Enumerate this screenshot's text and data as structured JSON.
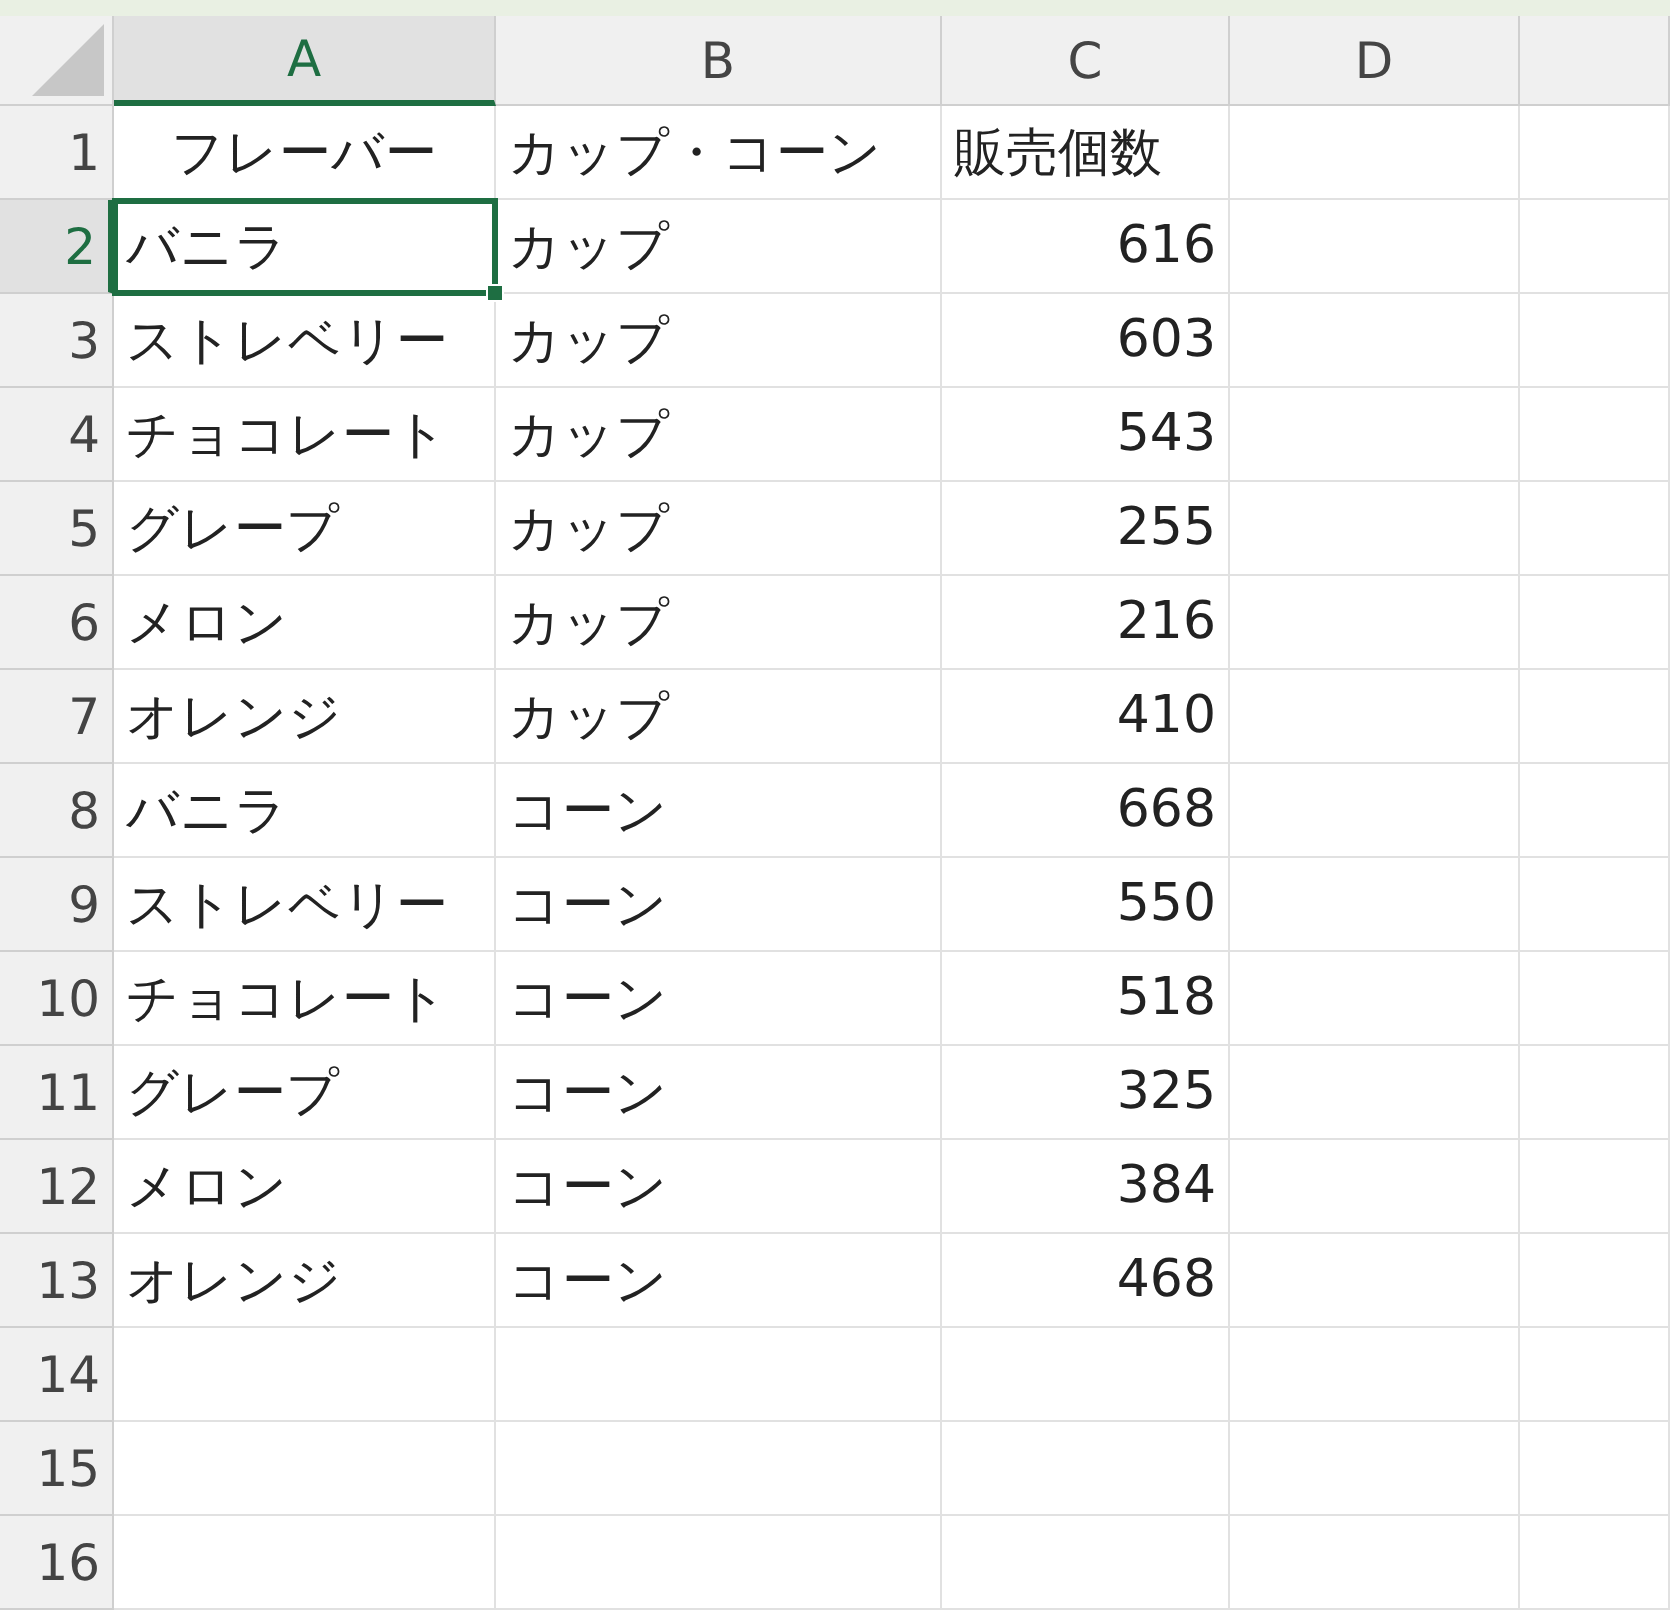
{
  "columns": [
    {
      "label": "A",
      "selected": true
    },
    {
      "label": "B",
      "selected": false
    },
    {
      "label": "C",
      "selected": false
    },
    {
      "label": "D",
      "selected": false
    },
    {
      "selected": false
    }
  ],
  "rows": [
    {
      "label": "1",
      "selected": false,
      "cells": [
        {
          "text": "フレーバー",
          "kind": "center"
        },
        {
          "text": "カップ・コーン",
          "kind": "text"
        },
        {
          "text": "販売個数",
          "kind": "text"
        }
      ]
    },
    {
      "label": "2",
      "selected": true,
      "cells": [
        {
          "text": "バニラ",
          "kind": "text"
        },
        {
          "text": "カップ",
          "kind": "text"
        },
        {
          "text": "616",
          "kind": "number"
        }
      ]
    },
    {
      "label": "3",
      "selected": false,
      "cells": [
        {
          "text": "ストレベリー",
          "kind": "text"
        },
        {
          "text": "カップ",
          "kind": "text"
        },
        {
          "text": "603",
          "kind": "number"
        }
      ]
    },
    {
      "label": "4",
      "selected": false,
      "cells": [
        {
          "text": "チョコレート",
          "kind": "text"
        },
        {
          "text": "カップ",
          "kind": "text"
        },
        {
          "text": "543",
          "kind": "number"
        }
      ]
    },
    {
      "label": "5",
      "selected": false,
      "cells": [
        {
          "text": "グレープ",
          "kind": "text"
        },
        {
          "text": "カップ",
          "kind": "text"
        },
        {
          "text": "255",
          "kind": "number"
        }
      ]
    },
    {
      "label": "6",
      "selected": false,
      "cells": [
        {
          "text": "メロン",
          "kind": "text"
        },
        {
          "text": "カップ",
          "kind": "text"
        },
        {
          "text": "216",
          "kind": "number"
        }
      ]
    },
    {
      "label": "7",
      "selected": false,
      "cells": [
        {
          "text": "オレンジ",
          "kind": "text"
        },
        {
          "text": "カップ",
          "kind": "text"
        },
        {
          "text": "410",
          "kind": "number"
        }
      ]
    },
    {
      "label": "8",
      "selected": false,
      "cells": [
        {
          "text": "バニラ",
          "kind": "text"
        },
        {
          "text": "コーン",
          "kind": "text"
        },
        {
          "text": "668",
          "kind": "number"
        }
      ]
    },
    {
      "label": "9",
      "selected": false,
      "cells": [
        {
          "text": "ストレベリー",
          "kind": "text"
        },
        {
          "text": "コーン",
          "kind": "text"
        },
        {
          "text": "550",
          "kind": "number"
        }
      ]
    },
    {
      "label": "10",
      "selected": false,
      "cells": [
        {
          "text": "チョコレート",
          "kind": "text"
        },
        {
          "text": "コーン",
          "kind": "text"
        },
        {
          "text": "518",
          "kind": "number"
        }
      ]
    },
    {
      "label": "11",
      "selected": false,
      "cells": [
        {
          "text": "グレープ",
          "kind": "text"
        },
        {
          "text": "コーン",
          "kind": "text"
        },
        {
          "text": "325",
          "kind": "number"
        }
      ]
    },
    {
      "label": "12",
      "selected": false,
      "cells": [
        {
          "text": "メロン",
          "kind": "text"
        },
        {
          "text": "コーン",
          "kind": "text"
        },
        {
          "text": "384",
          "kind": "number"
        }
      ]
    },
    {
      "label": "13",
      "selected": false,
      "cells": [
        {
          "text": "オレンジ",
          "kind": "text"
        },
        {
          "text": "コーン",
          "kind": "text"
        },
        {
          "text": "468",
          "kind": "number"
        }
      ]
    },
    {
      "label": "14",
      "selected": false,
      "cells": []
    },
    {
      "label": "15",
      "selected": false,
      "cells": []
    },
    {
      "label": "16",
      "selected": false,
      "cells": []
    }
  ]
}
